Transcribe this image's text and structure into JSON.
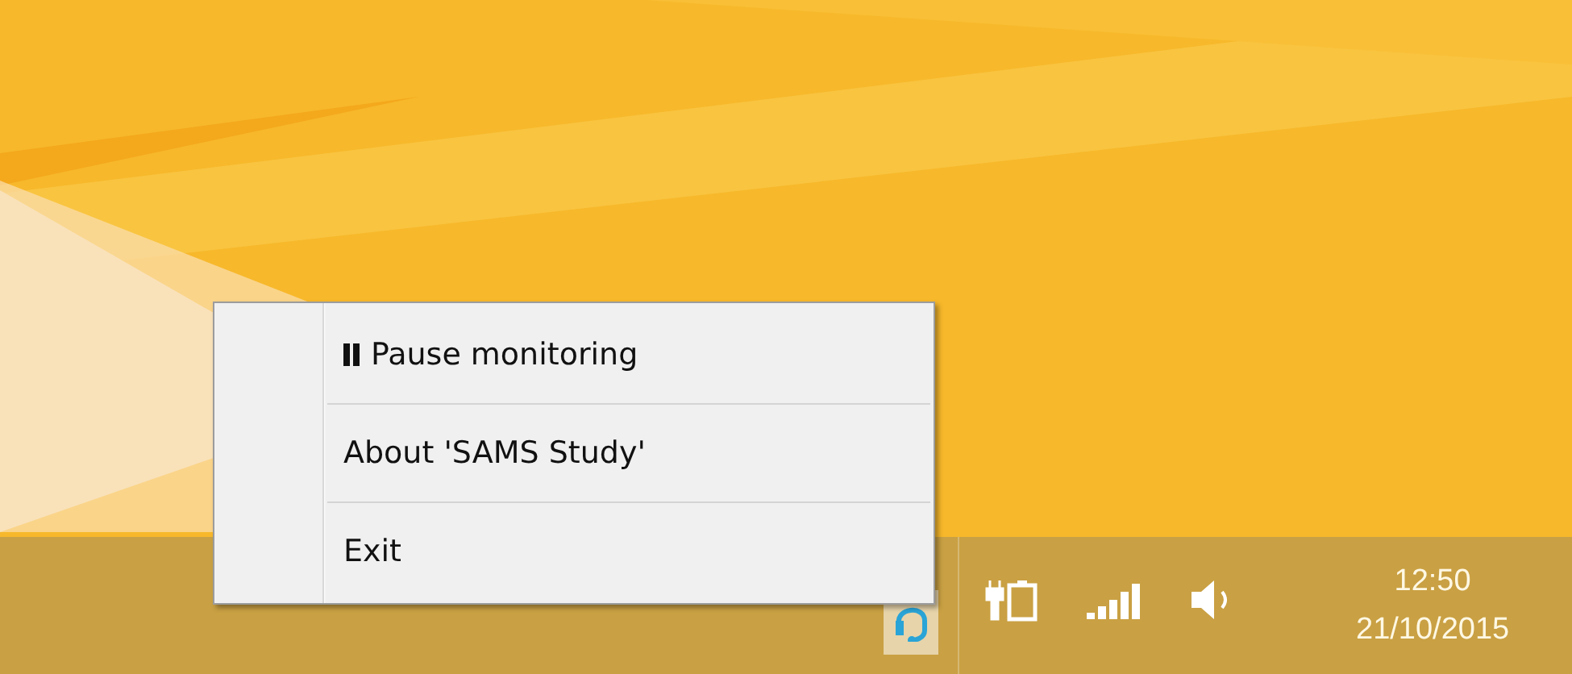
{
  "context_menu": {
    "items": [
      {
        "kind": "pause",
        "label": "Pause monitoring"
      },
      {
        "kind": "plain",
        "label": "About 'SAMS Study'"
      },
      {
        "kind": "plain",
        "label": "Exit"
      }
    ]
  },
  "taskbar": {
    "clock": {
      "time": "12:50",
      "date": "21/10/2015"
    }
  }
}
